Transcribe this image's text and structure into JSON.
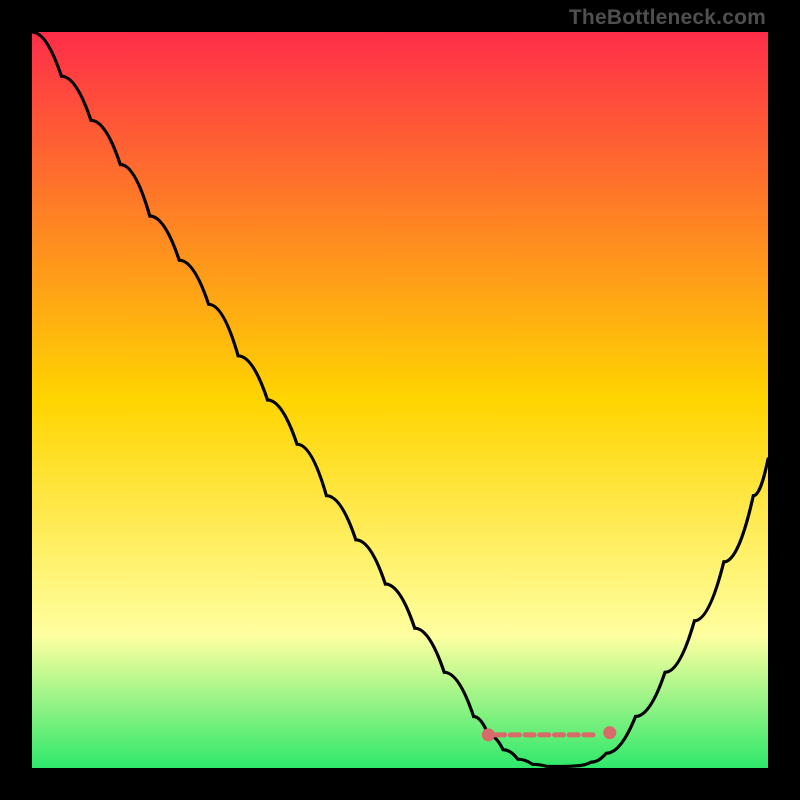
{
  "watermark": "TheBottleneck.com",
  "colors": {
    "gradient_top": "#ff2d49",
    "gradient_mid": "#ffd500",
    "gradient_low": "#ffffa0",
    "gradient_bottom": "#2ee86b",
    "curve": "#000000",
    "marker": "#d86a6a",
    "frame": "#000000"
  },
  "chart_data": {
    "type": "line",
    "title": "",
    "xlabel": "",
    "ylabel": "",
    "xlim": [
      0,
      100
    ],
    "ylim": [
      0,
      100
    ],
    "grid": false,
    "legend": false,
    "x": [
      0,
      4,
      8,
      12,
      16,
      20,
      24,
      28,
      32,
      36,
      40,
      44,
      48,
      52,
      56,
      60,
      62,
      64,
      66,
      68,
      70,
      72,
      74,
      76,
      78,
      82,
      86,
      90,
      94,
      98,
      100
    ],
    "y": [
      100,
      94,
      88,
      82,
      75,
      69,
      63,
      56,
      50,
      44,
      37,
      31,
      25,
      19,
      13,
      7,
      4.5,
      2.5,
      1.2,
      0.5,
      0.2,
      0.2,
      0.3,
      0.8,
      2,
      7,
      13,
      20,
      28,
      37,
      42
    ],
    "flat_zone": {
      "x_start": 62,
      "x_end": 78,
      "y": 0.6
    },
    "markers": [
      {
        "x": 62,
        "y": 4.5
      },
      {
        "x": 78.5,
        "y": 4.8
      }
    ],
    "dash_segment": {
      "x": [
        63,
        65,
        67,
        69,
        71,
        73,
        75,
        77
      ],
      "y": 4.5
    }
  }
}
